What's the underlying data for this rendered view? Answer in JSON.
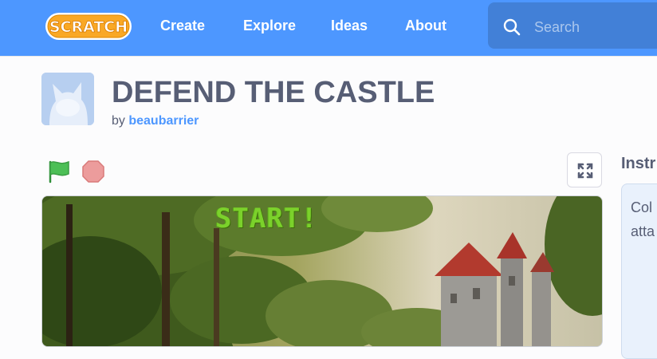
{
  "nav": {
    "logo_text": "SCRATCH",
    "links": [
      "Create",
      "Explore",
      "Ideas",
      "About"
    ],
    "search_placeholder": "Search"
  },
  "project": {
    "title": "DEFEND THE CASTLE",
    "by_label": "by",
    "author": "beaubarrier"
  },
  "stage": {
    "overlay_text": "START!"
  },
  "instructions": {
    "heading": "Instr",
    "text": "Col\natta"
  },
  "colors": {
    "nav_bg": "#4d97ff",
    "search_bg": "#4280d7",
    "title": "#575e75",
    "link": "#4d97ff",
    "flag": "#4cbf56",
    "stop": "#ec9c9c",
    "start_text": "#7bd12b"
  },
  "icons": {
    "logo": "scratch-logo",
    "search": "search-icon",
    "avatar": "cat-avatar",
    "green_flag": "green-flag-icon",
    "stop": "stop-icon",
    "fullscreen": "fullscreen-icon"
  }
}
